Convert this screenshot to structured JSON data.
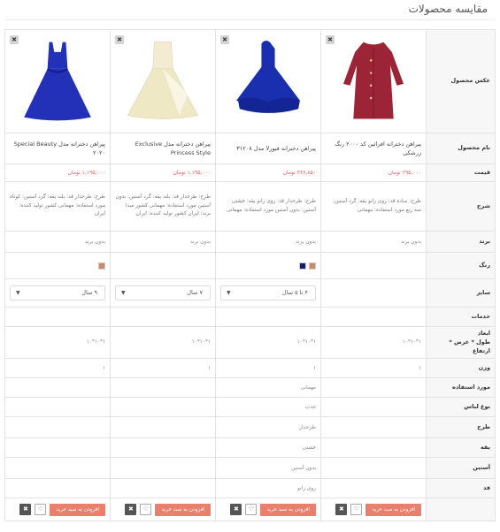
{
  "page": {
    "title": "مقایسه محصولات"
  },
  "labels": {
    "image": "عکس محصول",
    "name": "نام محصول",
    "price": "قیمت",
    "desc": "شرح",
    "brand": "برند",
    "color": "رنگ",
    "size": "سایز",
    "services": "خدمات",
    "dims": "ابعاد\nطول * عرض * ارتفاع",
    "weight": "وزن",
    "usage": "مورد استفاده",
    "clothtype": "نوع لباس",
    "design": "طرح",
    "collar": "یقه",
    "sleeve": "آستین",
    "length": "قد"
  },
  "icons": {
    "remove": "close-icon",
    "wishlist": "heart-icon",
    "compare_remove": "close-icon"
  },
  "colors": {
    "accent": "#e9806e",
    "price": "#e55a5a"
  },
  "products": [
    {
      "name": "پیراهن دخترانه افرائین کد ۲۰۰۰ رنگ زرشکی",
      "price": "۲۹۵,۰۰۰ تومان",
      "desc": "طرح: ساده قد: روی زانو یقه: گرد آستین: سه ربع مورد استفاده: مهمانی",
      "brand": "بدون برند",
      "swatches": [],
      "size": "",
      "dims": "۱۰*۱۰*۱",
      "weight": "۱",
      "usage": "",
      "clothtype": "",
      "design": "",
      "collar": "",
      "sleeve": "",
      "length": "",
      "add_label": "افزودن به سبد خرید",
      "dress_color": "#9b2436"
    },
    {
      "name": "پیراهن دخترانه فیورلا مدل ۳۱۲۰۸",
      "price": "۳۶۶,۸۵۰ تومان",
      "desc": "طرح: طرحدار قد: روی زانو یقه: خشتی آستین: بدون آستین مورد استفاده: مهمانی",
      "brand": "بدون برند",
      "swatches": [
        "#111c7a",
        "#c88a6a"
      ],
      "size": "۴ تا ۵ سال",
      "dims": "۱۰*۱۰*۱",
      "weight": "۱",
      "usage": "مهمانی",
      "clothtype": "جذب",
      "design": "طرحدار",
      "collar": "خشتی",
      "sleeve": "بدون آستین",
      "length": "روی زانو",
      "add_label": "افزودن به سبد خرید",
      "dress_color": "#1a2fb0"
    },
    {
      "name": "پیراهن دخترانه مدل Exclusive Princess Style",
      "price": "۱,۱۹۵,۰۰۰ تومان",
      "desc": "طرح: طرحدار قد: بلند یقه: گرد آستین: بدون آستین مورد استفاده: مهمانی کشور مبدا برند: ایران کشور تولید کننده: ایران",
      "brand": "بدون برند",
      "swatches": [],
      "size": "۷ سال",
      "dims": "۱۰*۱۰*۱",
      "weight": "۱",
      "usage": "",
      "clothtype": "",
      "design": "",
      "collar": "",
      "sleeve": "",
      "length": "",
      "add_label": "افزودن به سبد خرید",
      "dress_color": "#f3ecd2"
    },
    {
      "name": "پیراهن دخترانه مدل Special Beauty ۲۰۲۰",
      "price": "۱,۱۹۵,۰۰۰ تومان",
      "desc": "طرح: طرحدار قد: بلند یقه: گرد آستین: کوتاه مورد استفاده: مهمانی کشور تولید کننده: ایران",
      "brand": "بدون برند",
      "swatches": [
        "#c88a6a"
      ],
      "size": "۹ سال",
      "dims": "۱۰*۱۰*۱",
      "weight": "۱",
      "usage": "",
      "clothtype": "",
      "design": "",
      "collar": "",
      "sleeve": "",
      "length": "",
      "add_label": "افزودن به سبد خرید",
      "dress_color": "#2330b8"
    }
  ]
}
